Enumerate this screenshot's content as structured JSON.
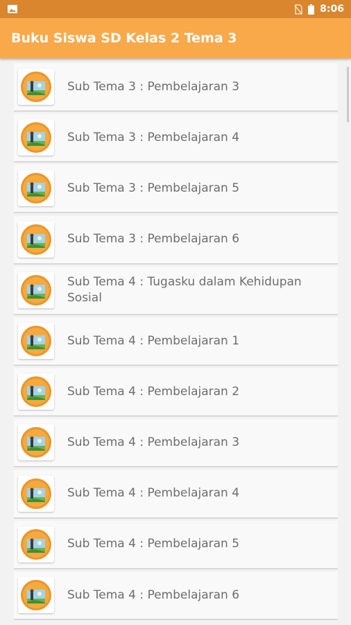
{
  "status_bar": {
    "time": "8:06",
    "left_icon": "image-notification-icon",
    "signal_icon": "no-sim-icon",
    "battery_icon": "battery-icon"
  },
  "app_bar": {
    "title": "Buku Siswa SD Kelas 2 Tema 3",
    "color": "#f9a94a"
  },
  "list": {
    "items": [
      {
        "label": "Sub Tema 3 : Pembelajaran 3",
        "icon": "book-cover-icon"
      },
      {
        "label": "Sub Tema 3 : Pembelajaran 4",
        "icon": "book-cover-icon"
      },
      {
        "label": "Sub Tema 3 : Pembelajaran 5",
        "icon": "book-cover-icon"
      },
      {
        "label": "Sub Tema 3 : Pembelajaran 6",
        "icon": "book-cover-icon"
      },
      {
        "label": "Sub Tema 4 : Tugasku dalam Kehidupan Sosial",
        "icon": "book-cover-icon"
      },
      {
        "label": "Sub Tema 4 : Pembelajaran 1",
        "icon": "book-cover-icon"
      },
      {
        "label": "Sub Tema 4 : Pembelajaran 2",
        "icon": "book-cover-icon"
      },
      {
        "label": "Sub Tema 4 : Pembelajaran 3",
        "icon": "book-cover-icon"
      },
      {
        "label": "Sub Tema 4 : Pembelajaran 4",
        "icon": "book-cover-icon"
      },
      {
        "label": "Sub Tema 4 : Pembelajaran 5",
        "icon": "book-cover-icon"
      },
      {
        "label": "Sub Tema 4 : Pembelajaran 6",
        "icon": "book-cover-icon"
      }
    ]
  }
}
